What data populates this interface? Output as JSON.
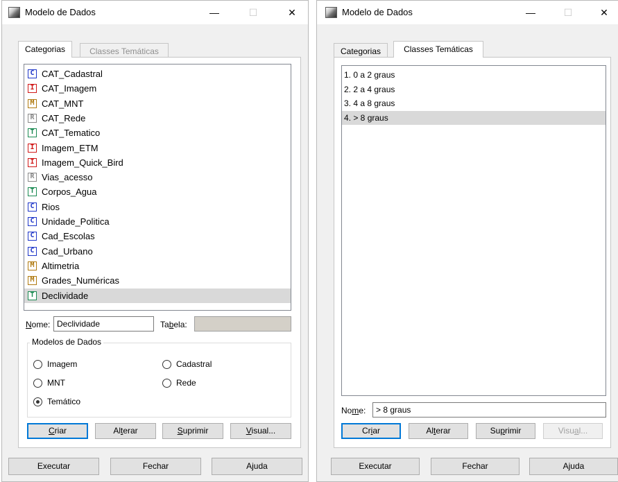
{
  "left_dialog": {
    "title": "Modelo de Dados",
    "window_controls": {
      "minimize": "—",
      "maximize": "☐",
      "close": "✕"
    },
    "tabs": [
      {
        "label": "Categorias",
        "active": true
      },
      {
        "label": "Classes Temáticas",
        "active": false
      }
    ],
    "categories": [
      {
        "badge": "C",
        "color": "#1d35c8",
        "label": "CAT_Cadastral"
      },
      {
        "badge": "I",
        "color": "#d01818",
        "label": "CAT_Imagem"
      },
      {
        "badge": "M",
        "color": "#b07a10",
        "label": "CAT_MNT"
      },
      {
        "badge": "R",
        "color": "#8a8a8a",
        "label": "CAT_Rede"
      },
      {
        "badge": "T",
        "color": "#1a8a52",
        "label": "CAT_Tematico"
      },
      {
        "badge": "I",
        "color": "#d01818",
        "label": "Imagem_ETM"
      },
      {
        "badge": "I",
        "color": "#d01818",
        "label": "Imagem_Quick_Bird"
      },
      {
        "badge": "R",
        "color": "#8a8a8a",
        "label": "Vias_acesso"
      },
      {
        "badge": "T",
        "color": "#1a8a52",
        "label": "Corpos_Agua"
      },
      {
        "badge": "C",
        "color": "#1d35c8",
        "label": "Rios"
      },
      {
        "badge": "C",
        "color": "#1d35c8",
        "label": "Unidade_Politica"
      },
      {
        "badge": "C",
        "color": "#1d35c8",
        "label": "Cad_Escolas"
      },
      {
        "badge": "C",
        "color": "#1d35c8",
        "label": "Cad_Urbano"
      },
      {
        "badge": "M",
        "color": "#b07a10",
        "label": "Altimetria"
      },
      {
        "badge": "M",
        "color": "#b07a10",
        "label": "Grades_Numéricas"
      },
      {
        "badge": "T",
        "color": "#1a8a52",
        "label": "Declividade",
        "selected": true
      }
    ],
    "nome_label_prefix": "N",
    "nome_label_rest": "ome:",
    "nome_value": "Declividade",
    "tabela_label_a": "Ta",
    "tabela_label_u": "b",
    "tabela_label_b": "ela:",
    "tabela_value": "",
    "group_title": "Modelos de Dados",
    "radios": [
      {
        "label": "Imagem",
        "checked": false
      },
      {
        "label": "Cadastral",
        "checked": false
      },
      {
        "label": "MNT",
        "checked": false
      },
      {
        "label": "Rede",
        "checked": false
      },
      {
        "label": "Temático",
        "checked": true
      }
    ],
    "action_buttons": [
      {
        "u": "C",
        "rest": "riar",
        "pre": ""
      },
      {
        "pre": "Al",
        "u": "t",
        "rest": "erar"
      },
      {
        "pre": "",
        "u": "S",
        "rest": "uprimir"
      },
      {
        "pre": "",
        "u": "V",
        "rest": "isual..."
      }
    ],
    "bottom_buttons": [
      "Executar",
      "Fechar",
      "Ajuda"
    ]
  },
  "right_dialog": {
    "title": "Modelo de Dados",
    "window_controls": {
      "minimize": "—",
      "maximize": "☐",
      "close": "✕"
    },
    "tabs": [
      {
        "label": "Categorias",
        "active": false
      },
      {
        "label": "Classes Temáticas",
        "active": true
      }
    ],
    "classes": [
      {
        "label": "1. 0 a 2 graus"
      },
      {
        "label": "2. 2 a 4 graus"
      },
      {
        "label": "3. 4 a 8 graus"
      },
      {
        "label": "4. > 8 graus",
        "selected": true
      }
    ],
    "nome_label_a": "No",
    "nome_label_u": "m",
    "nome_label_b": "e:",
    "nome_value": "> 8 graus",
    "action_buttons": [
      {
        "pre": "Cr",
        "u": "i",
        "rest": "ar"
      },
      {
        "pre": "Al",
        "u": "t",
        "rest": "erar"
      },
      {
        "pre": "Su",
        "u": "p",
        "rest": "rimir"
      },
      {
        "pre": "Visu",
        "u": "a",
        "rest": "l..."
      }
    ],
    "bottom_buttons": [
      "Executar",
      "Fechar",
      "Ajuda"
    ]
  }
}
